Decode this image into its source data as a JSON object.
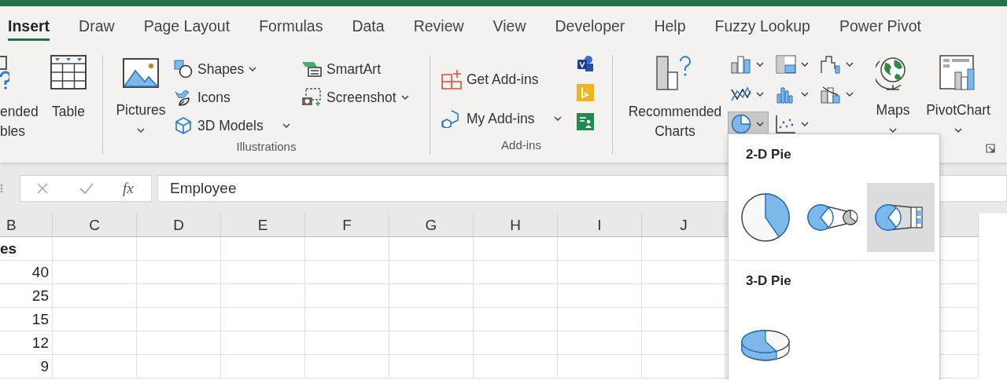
{
  "tabs": [
    {
      "label": "Insert",
      "selected": true
    },
    {
      "label": "Draw",
      "selected": false
    },
    {
      "label": "Page Layout",
      "selected": false
    },
    {
      "label": "Formulas",
      "selected": false
    },
    {
      "label": "Data",
      "selected": false
    },
    {
      "label": "Review",
      "selected": false
    },
    {
      "label": "View",
      "selected": false
    },
    {
      "label": "Developer",
      "selected": false
    },
    {
      "label": "Help",
      "selected": false
    },
    {
      "label": "Fuzzy Lookup",
      "selected": false
    },
    {
      "label": "Power Pivot",
      "selected": false
    }
  ],
  "ribbon": {
    "tables": {
      "pivot_tables": [
        "ended",
        "bles"
      ],
      "table": "Table"
    },
    "illustrations": {
      "pictures": "Pictures",
      "shapes": "Shapes",
      "icons": "Icons",
      "models_3d": "3D Models",
      "smartart": "SmartArt",
      "screenshot": "Screenshot",
      "label": "Illustrations"
    },
    "addins": {
      "get_addins": "Get Add-ins",
      "my_addins": "My Add-ins",
      "label": "Add-ins"
    },
    "charts": {
      "recommended": [
        "Recommended",
        "Charts"
      ],
      "chart_types": [
        {
          "kind": "column",
          "selected": false
        },
        {
          "kind": "hierarchy",
          "selected": false
        },
        {
          "kind": "waterfall",
          "selected": false
        },
        {
          "kind": "line",
          "selected": false
        },
        {
          "kind": "statistic",
          "selected": false
        },
        {
          "kind": "combo",
          "selected": false
        },
        {
          "kind": "pie",
          "selected": true
        },
        {
          "kind": "scatter",
          "selected": false
        }
      ],
      "maps": "Maps",
      "pivot_chart": "PivotChart"
    }
  },
  "formula_bar": {
    "function_label": "fx",
    "value": "Employee"
  },
  "sheet": {
    "columns": [
      "B",
      "C",
      "D",
      "E",
      "F",
      "G",
      "H",
      "I",
      "J"
    ],
    "rows": [
      {
        "kind": "header",
        "value": "es"
      },
      {
        "kind": "number",
        "value": "40"
      },
      {
        "kind": "number",
        "value": "25"
      },
      {
        "kind": "number",
        "value": "15"
      },
      {
        "kind": "number",
        "value": "12"
      },
      {
        "kind": "number",
        "value": "9"
      }
    ]
  },
  "pie_menu": {
    "sections": [
      {
        "title": "2-D Pie",
        "options": [
          {
            "kind": "pie",
            "selected": false
          },
          {
            "kind": "pie_of_pie",
            "selected": false
          },
          {
            "kind": "bar_of_pie",
            "selected": true
          }
        ]
      },
      {
        "title": "3-D Pie",
        "options": [
          {
            "kind": "pie_3d",
            "selected": false
          }
        ]
      }
    ]
  }
}
